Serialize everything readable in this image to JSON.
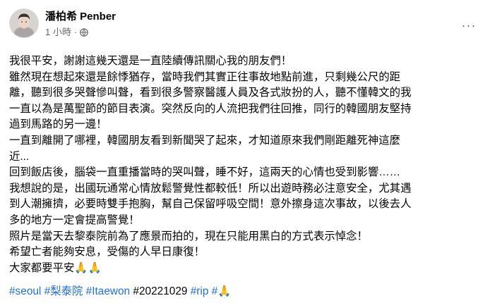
{
  "post": {
    "author": "潘柏希 Penber",
    "timestamp": "1 小時",
    "separator": "·",
    "more_label": "···",
    "lines": [
      "我很平安，謝謝這幾天還是一直陸續傳訊關心我的朋友們！",
      "雖然現在想起來還是餘悸猶存，當時我們其實正往事故地點前進，只剩幾公尺的距",
      "離，聽到很多哭聲慘叫聲，看到很多警察醫護人員及各式妝扮的人，聽不懂韓文的我",
      "一直以為是萬聖節的節目表演。突然反向的人流把我們往回推，同行的韓國朋友堅持",
      "過到馬路的另一邊！",
      "一直到離開了哪裡，韓國朋友看到新聞哭了起來，才知道原來我們剛距離死神這麼",
      "近...",
      "回到飯店後，腦袋一直重播當時的哭叫聲，睡不好，這兩天的心情也受到影響……",
      "我想說的是，出國玩通常心情放鬆警覺性都較低！所以出遊時務必注意安全，尤其遇",
      "到人潮擁擠，必要時雙手抱胸，幫自己保留呼吸空間！意外擦身這次事故，以後去人",
      "多的地方一定會提高警覺！",
      "照片是當天去黎泰院前為了應景而拍的，現在只能用黑白的方式表示悼念！",
      "希望亡者能夠安息，受傷的人早日康復！",
      "大家都要平安🙏🙏"
    ],
    "hashtags": [
      "#seoul",
      "#梨泰院",
      "#Itaewon"
    ],
    "plain_tag": "#20221029",
    "hashtag_rip": "#rip",
    "final_tag": "#🙏"
  },
  "colors": {
    "link": "#216fdb",
    "meta": "#65676b",
    "text": "#050505"
  },
  "icons": [
    "globe-icon",
    "more-options-icon",
    "avatar"
  ]
}
